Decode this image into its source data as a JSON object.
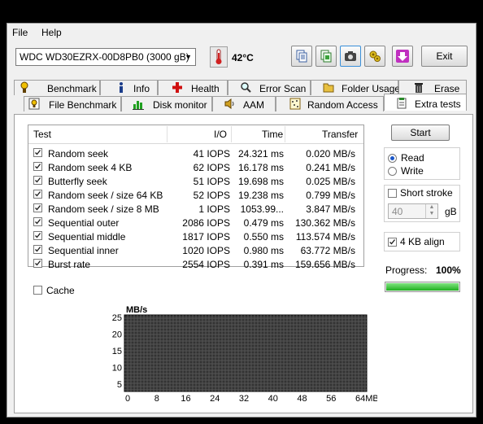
{
  "menu": {
    "file": "File",
    "help": "Help"
  },
  "toolbar": {
    "drive": "WDC WD30EZRX-00D8PB0 (3000 gB)",
    "temperature": "42°C",
    "exit_label": "Exit",
    "icons": [
      "copy-text-icon",
      "copy-info-icon",
      "screenshot-icon",
      "options-icon",
      "save-icon"
    ]
  },
  "tabs_top": [
    "Benchmark",
    "Info",
    "Health",
    "Error Scan",
    "Folder Usage",
    "Erase"
  ],
  "tabs_bottom": [
    "File Benchmark",
    "Disk monitor",
    "AAM",
    "Random Access",
    "Extra tests"
  ],
  "table": {
    "headers": {
      "test": "Test",
      "io": "I/O",
      "time": "Time",
      "transfer": "Transfer"
    },
    "rows": [
      {
        "test": "Random seek",
        "io": "41 IOPS",
        "time": "24.321 ms",
        "transfer": "0.020 MB/s",
        "checked": true
      },
      {
        "test": "Random seek 4 KB",
        "io": "62 IOPS",
        "time": "16.178 ms",
        "transfer": "0.241 MB/s",
        "checked": true
      },
      {
        "test": "Butterfly seek",
        "io": "51 IOPS",
        "time": "19.698 ms",
        "transfer": "0.025 MB/s",
        "checked": true
      },
      {
        "test": "Random seek / size 64 KB",
        "io": "52 IOPS",
        "time": "19.238 ms",
        "transfer": "0.799 MB/s",
        "checked": true
      },
      {
        "test": "Random seek / size 8 MB",
        "io": "1 IOPS",
        "time": "1053.99...",
        "transfer": "3.847 MB/s",
        "checked": true
      },
      {
        "test": "Sequential outer",
        "io": "2086 IOPS",
        "time": "0.479 ms",
        "transfer": "130.362 MB/s",
        "checked": true
      },
      {
        "test": "Sequential middle",
        "io": "1817 IOPS",
        "time": "0.550 ms",
        "transfer": "113.574 MB/s",
        "checked": true
      },
      {
        "test": "Sequential inner",
        "io": "1020 IOPS",
        "time": "0.980 ms",
        "transfer": "63.772 MB/s",
        "checked": true
      },
      {
        "test": "Burst rate",
        "io": "2554 IOPS",
        "time": "0.391 ms",
        "transfer": "159.656 MB/s",
        "checked": true
      }
    ]
  },
  "cache_label": "Cache",
  "start_label": "Start",
  "read_label": "Read",
  "write_label": "Write",
  "mode_selected": "Read",
  "short_stroke_label": "Short stroke",
  "short_stroke_value": "40",
  "gb_label": "gB",
  "align_label": "4 KB align",
  "progress_label": "Progress:",
  "progress_value": "100%",
  "progress_fraction": 1.0,
  "graph": {
    "ylabel": "MB/s",
    "yticks": [
      "25",
      "20",
      "15",
      "10",
      "5"
    ],
    "xticks": [
      "0",
      "8",
      "16",
      "24",
      "32",
      "40",
      "48",
      "56",
      "64MB"
    ]
  },
  "colors": {
    "progress_green": "#20b020",
    "graph_bg": "#333333"
  }
}
